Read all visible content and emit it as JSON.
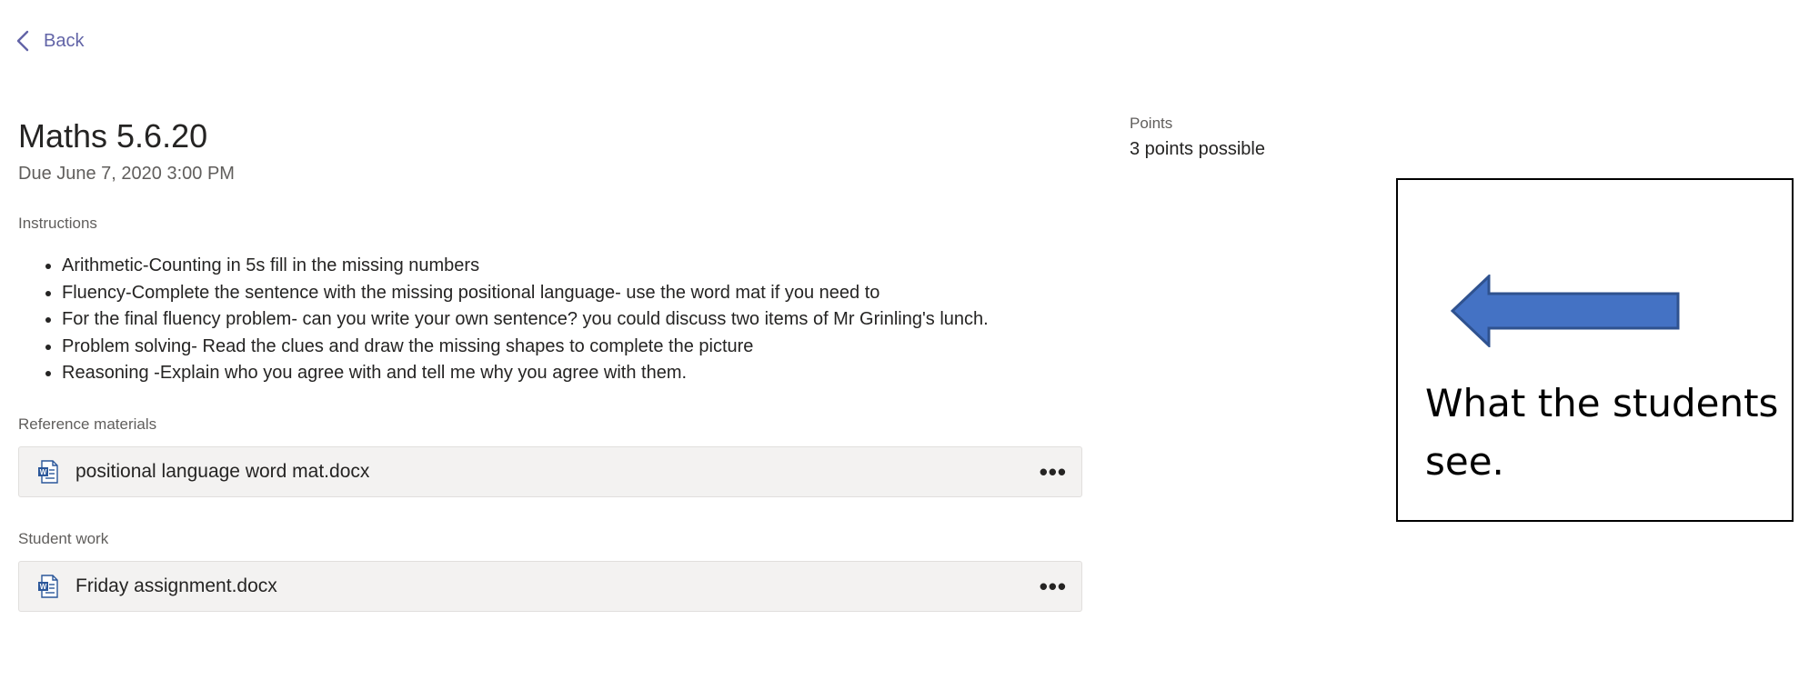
{
  "nav": {
    "back_label": "Back"
  },
  "assignment": {
    "title": "Maths 5.6.20",
    "due": "Due June 7, 2020 3:00 PM",
    "instructions_label": "Instructions",
    "instructions": [
      "Arithmetic-Counting in 5s fill in the missing numbers",
      "Fluency-Complete the sentence with the missing positional language- use the word mat if you need to",
      "For the final fluency problem- can you write your own sentence? you could discuss two items of Mr Grinling's lunch.",
      "Problem solving- Read the clues and draw the missing shapes to complete the picture",
      "Reasoning -Explain who you agree with and tell me why you agree with them."
    ],
    "reference_label": "Reference materials",
    "reference_files": [
      {
        "name": "positional language word mat.docx",
        "icon": "word-document-icon"
      }
    ],
    "student_work_label": "Student work",
    "student_files": [
      {
        "name": "Friday assignment.docx",
        "icon": "word-document-icon"
      }
    ]
  },
  "points": {
    "label": "Points",
    "value": "3 points possible"
  },
  "annotation": {
    "text": "What the students see.",
    "arrow_icon": "left-arrow-icon",
    "arrow_color": "#4472c4"
  },
  "colors": {
    "accent": "#6264a7",
    "card_background": "#f3f2f1",
    "word_blue": "#2b579a"
  }
}
